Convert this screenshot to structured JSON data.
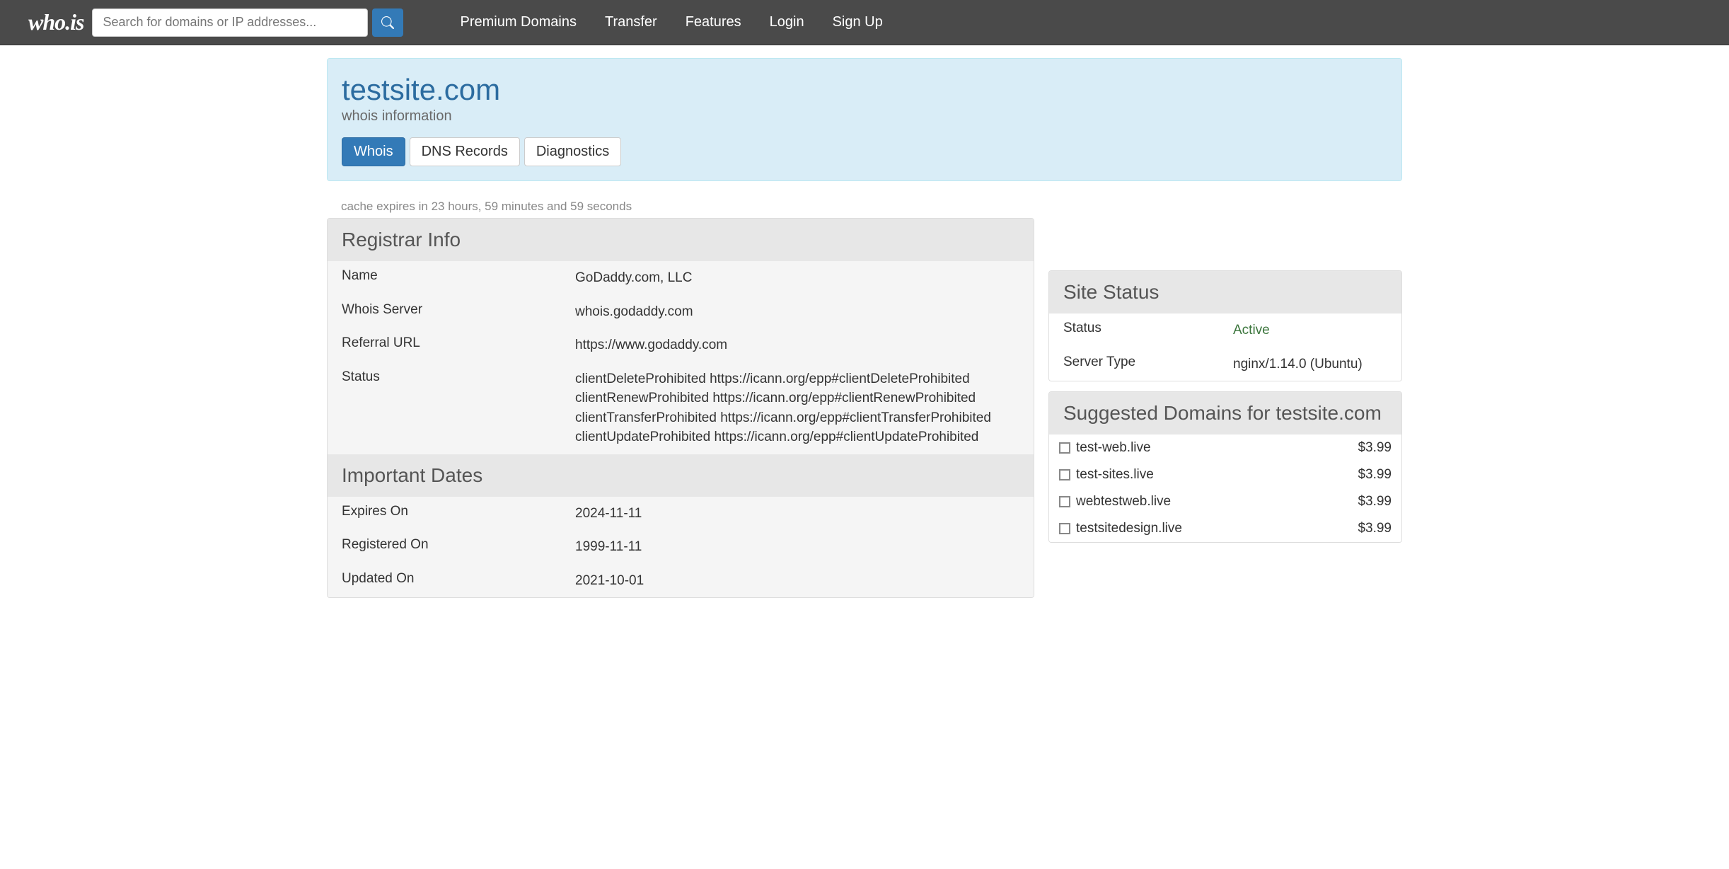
{
  "nav": {
    "logo_text": "who.is",
    "search_placeholder": "Search for domains or IP addresses...",
    "links": [
      "Premium Domains",
      "Transfer",
      "Features",
      "Login",
      "Sign Up"
    ]
  },
  "header": {
    "domain": "testsite.com",
    "subtitle": "whois information",
    "tabs": [
      "Whois",
      "DNS Records",
      "Diagnostics"
    ]
  },
  "cache_note": "cache expires in 23 hours, 59 minutes and 59 seconds",
  "registrar_info": {
    "title": "Registrar Info",
    "rows": [
      {
        "label": "Name",
        "value": "GoDaddy.com, LLC"
      },
      {
        "label": "Whois Server",
        "value": "whois.godaddy.com"
      },
      {
        "label": "Referral URL",
        "value": "https://www.godaddy.com"
      },
      {
        "label": "Status",
        "value": "clientDeleteProhibited https://icann.org/epp#clientDeleteProhibited\nclientRenewProhibited https://icann.org/epp#clientRenewProhibited\nclientTransferProhibited https://icann.org/epp#clientTransferProhibited\nclientUpdateProhibited https://icann.org/epp#clientUpdateProhibited"
      }
    ]
  },
  "important_dates": {
    "title": "Important Dates",
    "rows": [
      {
        "label": "Expires On",
        "value": "2024-11-11"
      },
      {
        "label": "Registered On",
        "value": "1999-11-11"
      },
      {
        "label": "Updated On",
        "value": "2021-10-01"
      }
    ]
  },
  "site_status": {
    "title": "Site Status",
    "rows": [
      {
        "label": "Status",
        "value": "Active",
        "active": true
      },
      {
        "label": "Server Type",
        "value": "nginx/1.14.0 (Ubuntu)"
      }
    ]
  },
  "suggested": {
    "title": "Suggested Domains for testsite.com",
    "items": [
      {
        "domain": "test-web.live",
        "price": "$3.99"
      },
      {
        "domain": "test-sites.live",
        "price": "$3.99"
      },
      {
        "domain": "webtestweb.live",
        "price": "$3.99"
      },
      {
        "domain": "testsitedesign.live",
        "price": "$3.99"
      }
    ]
  }
}
